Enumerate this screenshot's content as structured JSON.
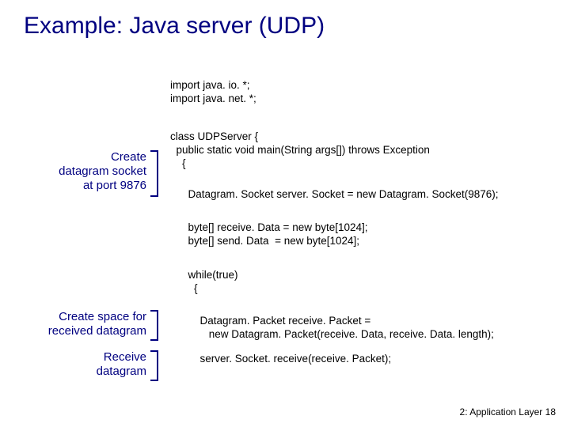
{
  "title": "Example: Java server (UDP)",
  "imports": "import java. io. *;\nimport java. net. *;",
  "class_decl": "class UDPServer {\n  public static void main(String args[]) throws Exception\n    {",
  "socket_line": "      Datagram. Socket server. Socket = new Datagram. Socket(9876);",
  "buffers": "      byte[] receive. Data = new byte[1024];\n      byte[] send. Data  = new byte[1024];",
  "while_open": "      while(true)\n        {",
  "packet_decl": "          Datagram. Packet receive. Packet =\n             new Datagram. Packet(receive. Data, receive. Data. length);",
  "receive_call": "          server. Socket. receive(receive. Packet);",
  "ann1_l1": "Create",
  "ann1_l2": "datagram socket",
  "ann1_l3": "at port 9876",
  "ann2_l1": "Create space for",
  "ann2_l2": "received datagram",
  "ann3_l1": "Receive",
  "ann3_l2": "datagram",
  "footer_text": "2: Application Layer",
  "footer_num": "18"
}
